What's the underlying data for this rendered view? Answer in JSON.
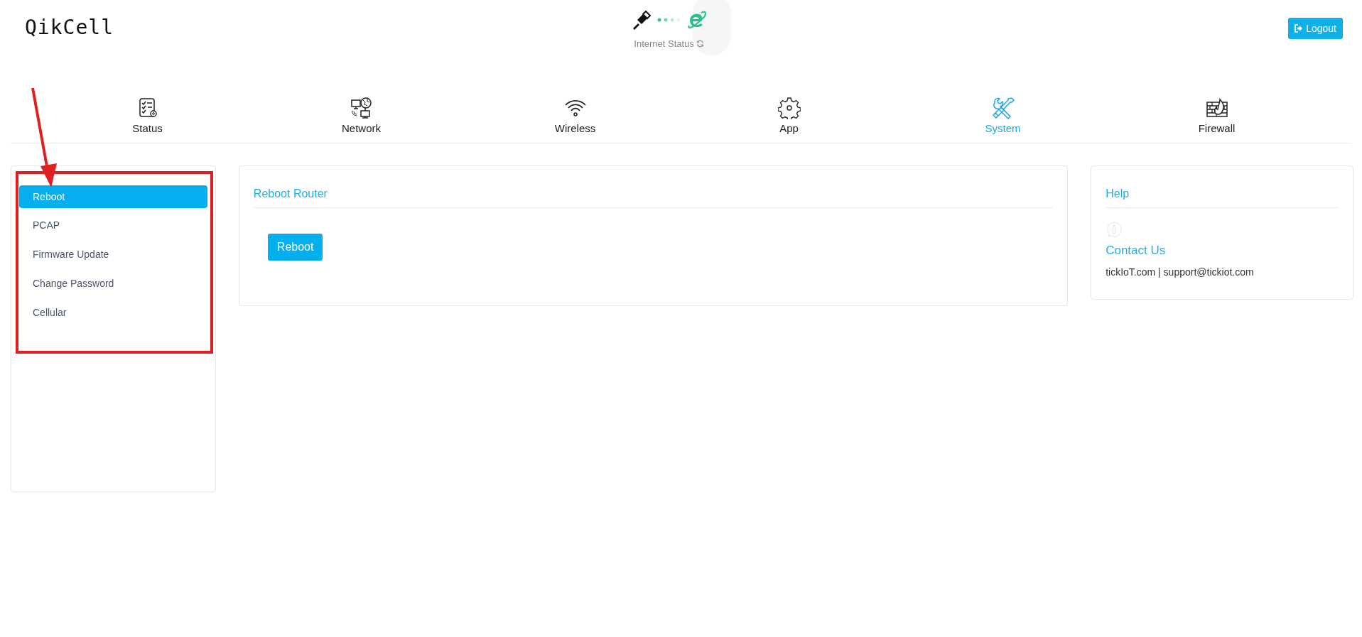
{
  "header": {
    "logo": "QikCell",
    "internet_status": "Internet Status",
    "logout": "Logout"
  },
  "nav": [
    {
      "label": "Status",
      "selected": false
    },
    {
      "label": "Network",
      "selected": false
    },
    {
      "label": "Wireless",
      "selected": false
    },
    {
      "label": "App",
      "selected": false
    },
    {
      "label": "System",
      "selected": true
    },
    {
      "label": "Firewall",
      "selected": false
    }
  ],
  "sidebar": {
    "items": [
      {
        "label": "Reboot",
        "selected": true
      },
      {
        "label": "PCAP",
        "selected": false
      },
      {
        "label": "Firmware Update",
        "selected": false
      },
      {
        "label": "Change Password",
        "selected": false
      },
      {
        "label": "Cellular",
        "selected": false
      }
    ]
  },
  "main": {
    "title": "Reboot Router",
    "button": "Reboot"
  },
  "help": {
    "title": "Help",
    "contact_title": "Contact Us",
    "contact_text": "tickIoT.com | support@tickiot.com"
  }
}
